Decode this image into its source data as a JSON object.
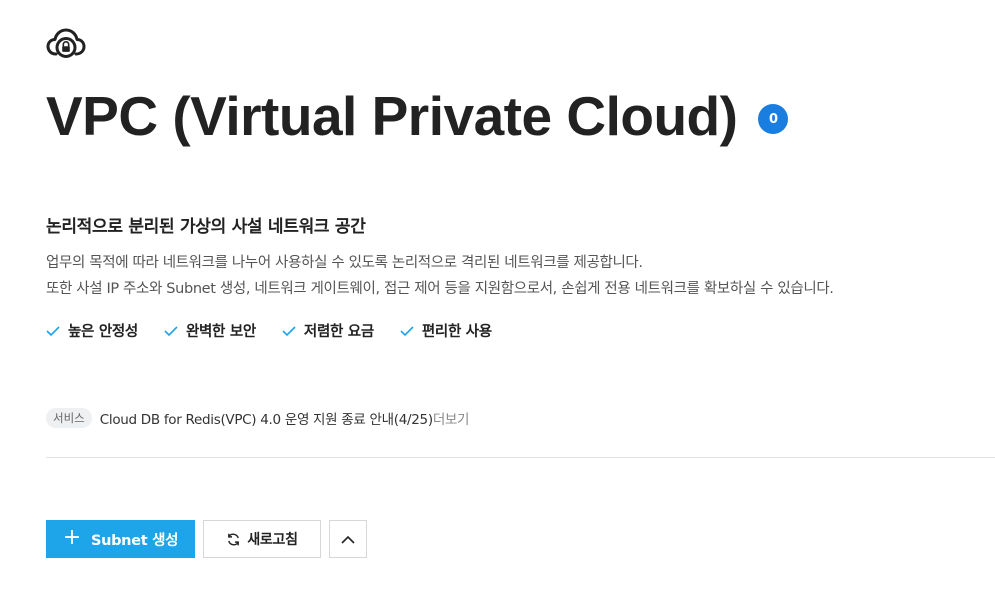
{
  "header": {
    "icon": "cloud-lock-icon",
    "title": "VPC (Virtual Private Cloud)",
    "count": "0",
    "accent": "#1a7de0"
  },
  "intro": {
    "heading": "논리적으로 분리된 가상의 사설 네트워크 공간",
    "description_line1": "업무의 목적에 따라 네트워크를 나누어 사용하실 수 있도록 논리적으로 격리된 네트워크를 제공합니다.",
    "description_line2": "또한 사설 IP 주소와 Subnet 생성, 네트워크 게이트웨이, 접근 제어 등을 지원함으로서, 손쉽게 전용 네트워크를 확보하실 수 있습니다."
  },
  "features": [
    {
      "label": "높은 안정성",
      "icon": "check-icon"
    },
    {
      "label": "완벽한 보안",
      "icon": "check-icon"
    },
    {
      "label": "저렴한 요금",
      "icon": "check-icon"
    },
    {
      "label": "편리한 사용",
      "icon": "check-icon"
    }
  ],
  "notice": {
    "badge": "서비스",
    "text": "Cloud DB for Redis(VPC) 4.0 운영 지원 종료 안내(4/25)",
    "more": "더보기"
  },
  "toolbar": {
    "create_label": "Subnet 생성",
    "refresh_label": "새로고침",
    "collapse_icon": "chevron-up-icon",
    "primary_color": "#1ea4e9"
  }
}
